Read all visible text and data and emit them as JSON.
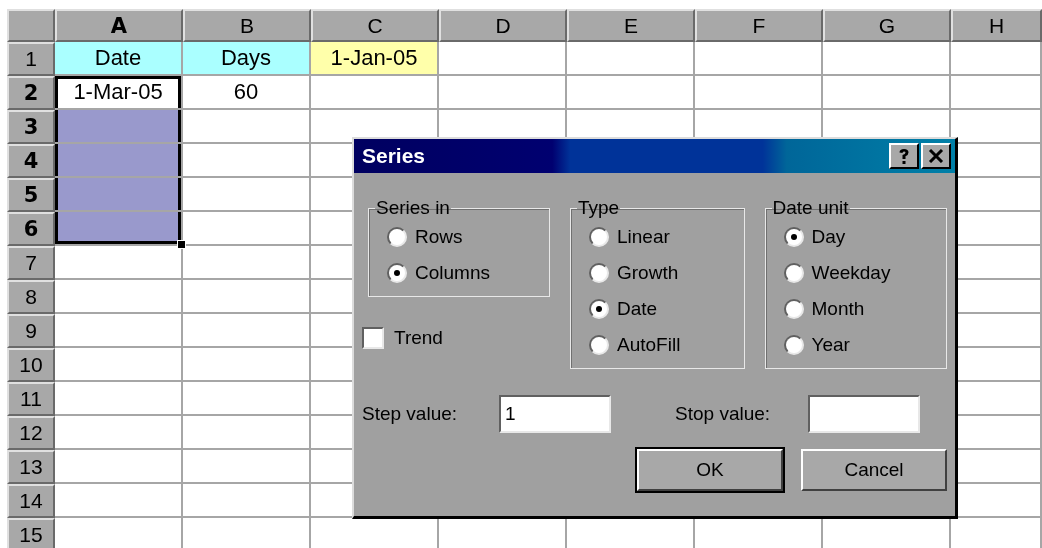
{
  "sheet": {
    "columns": [
      {
        "label": "A",
        "highlighted": true
      },
      {
        "label": "B",
        "highlighted": false
      },
      {
        "label": "C",
        "highlighted": false
      },
      {
        "label": "D",
        "highlighted": false
      },
      {
        "label": "E",
        "highlighted": false
      },
      {
        "label": "F",
        "highlighted": false
      },
      {
        "label": "G",
        "highlighted": false
      },
      {
        "label": "H",
        "highlighted": false
      }
    ],
    "rows": [
      {
        "header": "1",
        "highlighted": false,
        "cells": [
          {
            "text": "Date",
            "color": "#aaffff",
            "selected": false
          },
          {
            "text": "Days",
            "color": "#aaffff",
            "selected": false
          },
          {
            "text": "1-Jan-05",
            "color": "#ffffaa",
            "selected": false
          },
          {
            "selected": false
          },
          {
            "selected": false
          },
          {
            "selected": false
          },
          {
            "selected": false
          },
          {
            "selected": false
          }
        ]
      },
      {
        "header": "2",
        "highlighted": true,
        "cells": [
          {
            "text": "1-Mar-05",
            "selected": true,
            "active": true
          },
          {
            "text": "60",
            "selected": false
          },
          {
            "selected": false
          },
          {
            "selected": false
          },
          {
            "selected": false
          },
          {
            "selected": false
          },
          {
            "selected": false
          },
          {
            "selected": false
          }
        ]
      },
      {
        "header": "3",
        "highlighted": true,
        "cells": [
          {
            "selected": true
          },
          {
            "selected": false
          },
          {
            "selected": false
          },
          {
            "selected": false
          },
          {
            "selected": false
          },
          {
            "selected": false
          },
          {
            "selected": false
          },
          {
            "selected": false
          }
        ]
      },
      {
        "header": "4",
        "highlighted": true,
        "cells": [
          {
            "selected": true
          },
          {
            "selected": false
          },
          {
            "selected": false
          },
          {},
          {},
          {},
          {},
          {
            "selected": false
          }
        ]
      },
      {
        "header": "5",
        "highlighted": true,
        "cells": [
          {
            "selected": true
          },
          {
            "selected": false
          },
          {
            "selected": false
          },
          {},
          {},
          {},
          {},
          {
            "selected": false
          }
        ]
      },
      {
        "header": "6",
        "highlighted": true,
        "cells": [
          {
            "selected": true
          },
          {
            "selected": false
          },
          {
            "selected": false
          },
          {},
          {},
          {},
          {},
          {
            "selected": false
          }
        ]
      },
      {
        "header": "7",
        "highlighted": false,
        "cells": [
          {
            "selected": false
          },
          {
            "selected": false
          },
          {
            "selected": false
          },
          {},
          {},
          {},
          {},
          {
            "selected": false
          }
        ]
      },
      {
        "header": "8",
        "highlighted": false,
        "cells": [
          {
            "selected": false
          },
          {
            "selected": false
          },
          {
            "selected": false
          },
          {},
          {},
          {},
          {},
          {
            "selected": false
          }
        ]
      },
      {
        "header": "9",
        "highlighted": false,
        "cells": [
          {
            "selected": false
          },
          {
            "selected": false
          },
          {
            "selected": false
          },
          {},
          {},
          {},
          {},
          {
            "selected": false
          }
        ]
      },
      {
        "header": "10",
        "highlighted": false,
        "cells": [
          {
            "selected": false
          },
          {
            "selected": false
          },
          {
            "selected": false
          },
          {},
          {},
          {},
          {},
          {
            "selected": false
          }
        ]
      },
      {
        "header": "11",
        "highlighted": false,
        "cells": [
          {
            "selected": false
          },
          {
            "selected": false
          },
          {
            "selected": false
          },
          {},
          {},
          {},
          {},
          {
            "selected": false
          }
        ]
      },
      {
        "header": "12",
        "highlighted": false,
        "cells": [
          {
            "selected": false
          },
          {
            "selected": false
          },
          {
            "selected": false
          },
          {},
          {},
          {},
          {},
          {
            "selected": false
          }
        ]
      },
      {
        "header": "13",
        "highlighted": false,
        "cells": [
          {
            "selected": false
          },
          {
            "selected": false
          },
          {
            "selected": false
          },
          {},
          {},
          {},
          {},
          {
            "selected": false
          }
        ]
      },
      {
        "header": "14",
        "highlighted": false,
        "cells": [
          {
            "selected": false
          },
          {
            "selected": false
          },
          {
            "selected": false
          },
          {},
          {},
          {},
          {},
          {
            "selected": false
          }
        ]
      },
      {
        "header": "15",
        "highlighted": false,
        "cells": [
          {
            "selected": false
          },
          {
            "selected": false
          },
          {
            "selected": false
          },
          {
            "selected": false
          },
          {
            "selected": false
          },
          {
            "selected": false
          },
          {
            "selected": false
          },
          {
            "selected": false
          }
        ]
      }
    ]
  },
  "dialog": {
    "title": "Series",
    "groups": [
      {
        "label": "Series in",
        "options": [
          {
            "label": "Rows",
            "selected": false
          },
          {
            "label": "Columns",
            "selected": true
          }
        ]
      },
      {
        "label": "Type",
        "options": [
          {
            "label": "Linear",
            "selected": false
          },
          {
            "label": "Growth",
            "selected": false
          },
          {
            "label": "Date",
            "selected": true
          },
          {
            "label": "AutoFill",
            "selected": false
          }
        ]
      },
      {
        "label": "Date unit",
        "options": [
          {
            "label": "Day",
            "selected": true
          },
          {
            "label": "Weekday",
            "selected": false
          },
          {
            "label": "Month",
            "selected": false
          },
          {
            "label": "Year",
            "selected": false
          }
        ]
      }
    ],
    "trend": {
      "label": "Trend",
      "checked": false
    },
    "step": {
      "label": "Step value:",
      "value": "1"
    },
    "stop": {
      "label": "Stop value:"
    },
    "buttons": [
      {
        "label": "OK",
        "default": true
      },
      {
        "label": "Cancel",
        "default": false
      }
    ]
  }
}
